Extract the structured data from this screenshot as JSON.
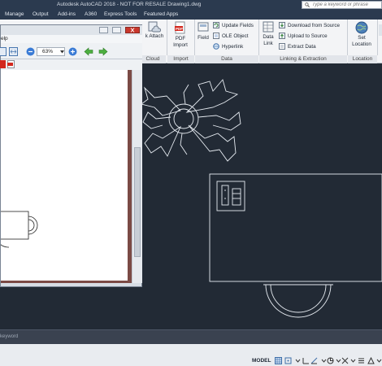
{
  "app": {
    "title": "Autodesk AutoCAD 2018 - NOT FOR RESALE   Drawing1.dwg",
    "search_placeholder": "Type a keyword or phrase"
  },
  "tabs": [
    "Manage",
    "Output",
    "Add-ins",
    "A360",
    "Express Tools",
    "Featured Apps"
  ],
  "ribbon": {
    "cloud_button": "k Attach",
    "cloud_panel": "Cloud",
    "pdf_import_label_1": "PDF",
    "pdf_import_label_2": "Import",
    "import_panel": "Import",
    "field_label": "Field",
    "update_fields": "Update Fields",
    "ole_object": "OLE Object",
    "hyperlink": "Hyperlink",
    "data_panel": "Data",
    "data_link_1": "Data",
    "data_link_2": "Link",
    "download_from_source": "Download from Source",
    "upload_to_source": "Upload to Source",
    "extract_data": "Extract  Data",
    "linking_panel": "Linking & Extraction",
    "set_location_1": "Set",
    "set_location_2": "Location",
    "location_panel": "Location"
  },
  "viewer": {
    "menu_partial": "elp",
    "zoom": "63%"
  },
  "command_line": {
    "text": "keyword"
  },
  "status": {
    "model": "MODEL"
  },
  "colors": {
    "canvas_bg": "#222a35",
    "drawing_lines": "#e6ebf1",
    "ribbon_bg": "#f3f4f6",
    "title_bg": "#2b3a4f"
  }
}
